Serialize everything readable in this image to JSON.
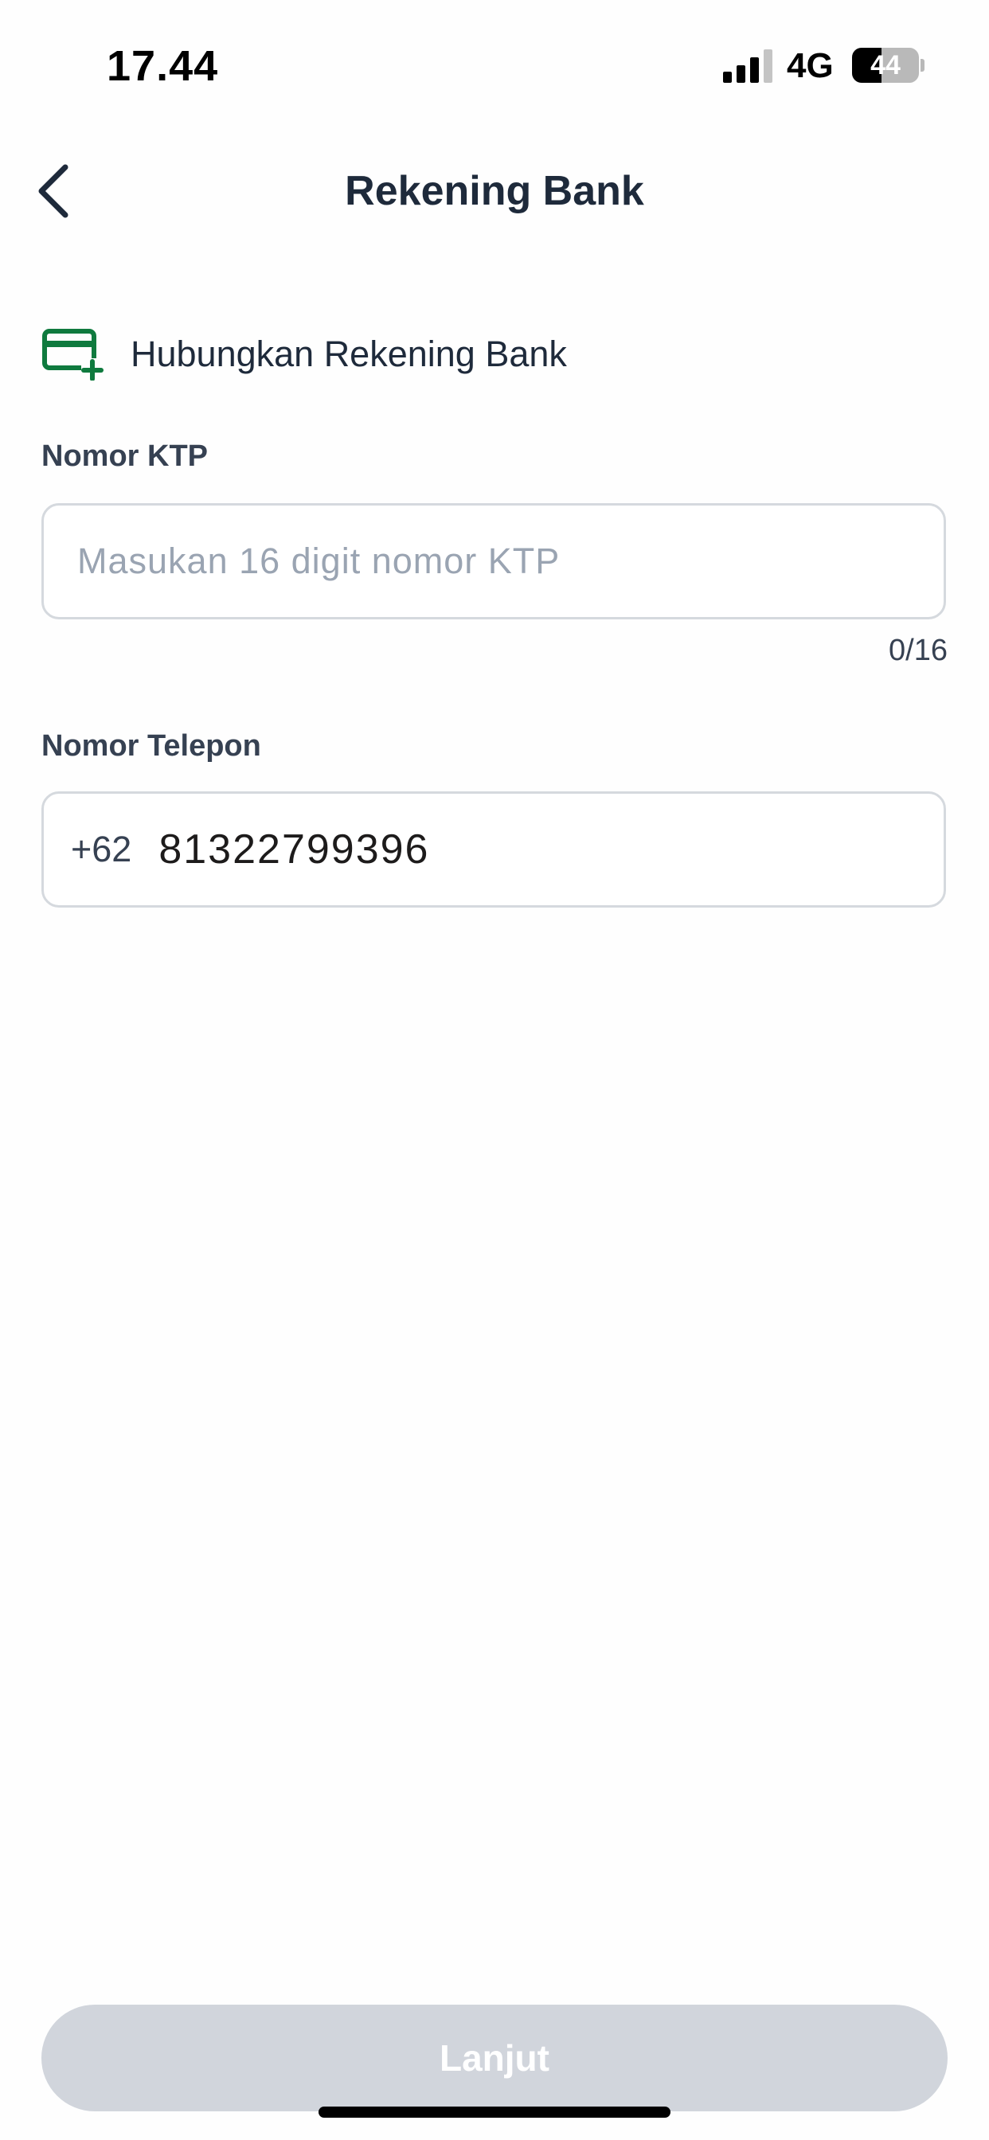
{
  "status_bar": {
    "time": "17.44",
    "network": "4G",
    "battery_level": "44",
    "battery_fraction": 0.44,
    "signal_bars_active": 3,
    "signal_bars_total": 4
  },
  "header": {
    "title": "Rekening Bank",
    "back_icon": "chevron-left-icon"
  },
  "section": {
    "title": "Hubungkan Rekening Bank",
    "icon": "card-add-icon",
    "icon_color": "#0f7a3e"
  },
  "ktp_field": {
    "label": "Nomor KTP",
    "placeholder": "Masukan 16 digit nomor KTP",
    "value": "",
    "counter": "0/16"
  },
  "phone_field": {
    "label": "Nomor Telepon",
    "country_code": "+62",
    "value": "81322799396"
  },
  "footer": {
    "next_label": "Lanjut",
    "next_enabled": false,
    "button_color": "#d1d5dc"
  }
}
